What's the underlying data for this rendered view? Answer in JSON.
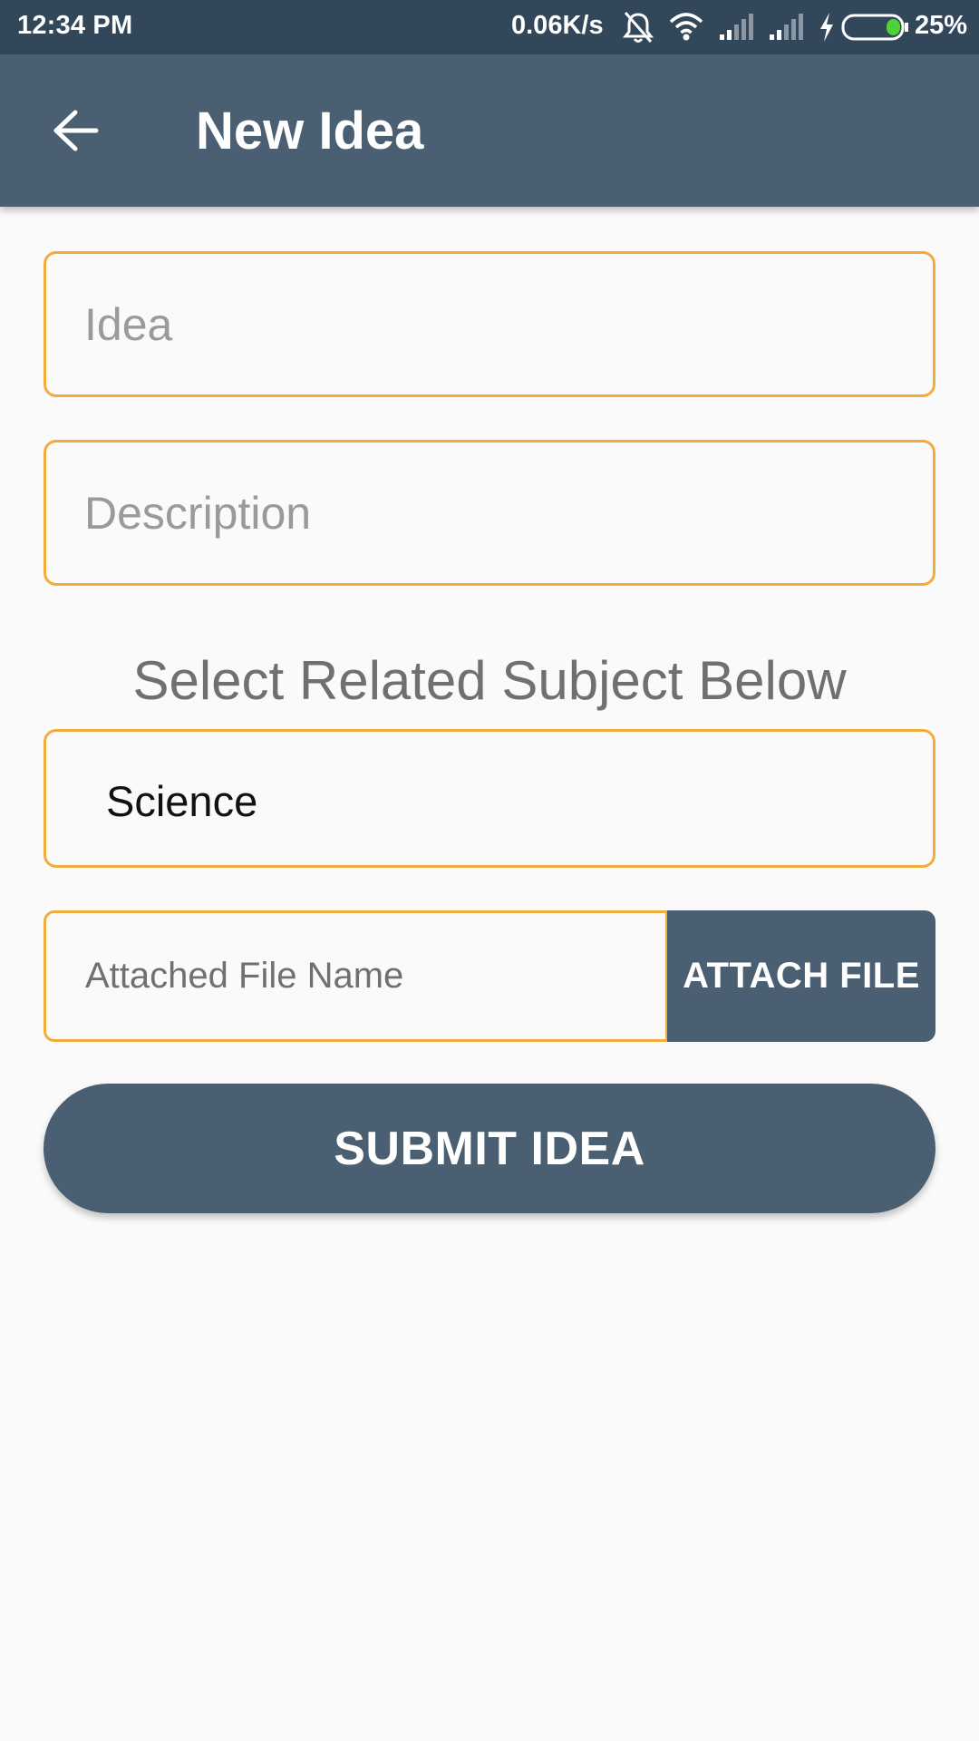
{
  "status_bar": {
    "time": "12:34 PM",
    "network_speed": "0.06K/s",
    "battery_percent": "25%",
    "battery_level": 0.25,
    "icons": [
      "alarm-off-icon",
      "wifi-icon",
      "signal-1-icon",
      "signal-2-icon",
      "charging-icon",
      "battery-icon"
    ]
  },
  "app_bar": {
    "title": "New Idea",
    "back_icon": "back-arrow-icon"
  },
  "form": {
    "idea_placeholder": "Idea",
    "description_placeholder": "Description",
    "subject_heading": "Select Related Subject Below",
    "subject_selected": "Science",
    "attached_file_placeholder": "Attached File Name",
    "attach_button_label": "ATTACH FILE",
    "submit_button_label": "SUBMIT IDEA"
  },
  "colors": {
    "status_bar": "#33475b",
    "primary": "#4a5f71",
    "field_border": "#f2ac3c",
    "background": "#fafafa",
    "battery_fill": "#4cd137"
  }
}
